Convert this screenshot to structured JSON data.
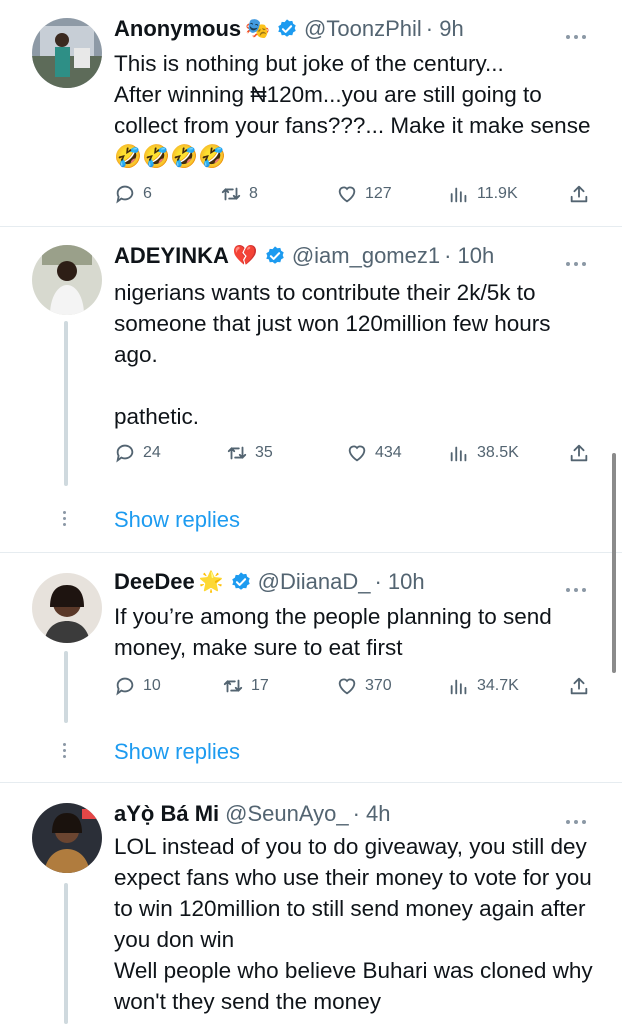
{
  "tweets": [
    {
      "name": "Anonymous",
      "name_emoji": "🎭",
      "handle": "@ToonzPhil",
      "time": "· 9h",
      "text": "This is nothing but joke of the century...\nAfter winning ₦120m...you are still going to collect from your fans???... Make it make sense 🤣🤣🤣🤣",
      "replies": "6",
      "retweets": "8",
      "likes": "127",
      "views": "11.9K",
      "verified": true
    },
    {
      "name": "ADEYINKA",
      "name_emoji": "💔",
      "handle": "@iam_gomez1",
      "time": "· 10h",
      "text": "nigerians wants to contribute their 2k/5k to someone that just won 120million few hours ago.\n\npathetic.",
      "replies": "24",
      "retweets": "35",
      "likes": "434",
      "views": "38.5K",
      "verified": true,
      "show_replies": "Show replies"
    },
    {
      "name": "DeeDee",
      "name_emoji": "🌟",
      "handle": "@DiianaD_",
      "time": "· 10h",
      "text": "If you’re among the people planning to send money, make sure to eat first",
      "replies": "10",
      "retweets": "17",
      "likes": "370",
      "views": "34.7K",
      "verified": true,
      "show_replies": "Show replies"
    },
    {
      "name": "aYọ̀ Bá Mi",
      "name_emoji": "",
      "handle": "@SeunAyo_",
      "time": "· 4h",
      "text": "LOL instead of you to do giveaway, you still dey expect fans who use their money to vote for you to win 120million to still send money again after you don win\nWell people who believe Buhari was cloned why won't they send the money",
      "verified": false
    }
  ],
  "colors": {
    "accent": "#1d9bf0",
    "text": "#0f1419",
    "secondary": "#536471",
    "separator": "#e6ecf0"
  },
  "icons": [
    "reply-icon",
    "retweet-icon",
    "like-icon",
    "views-icon",
    "share-icon",
    "verified-badge-icon",
    "more-options-icon"
  ]
}
